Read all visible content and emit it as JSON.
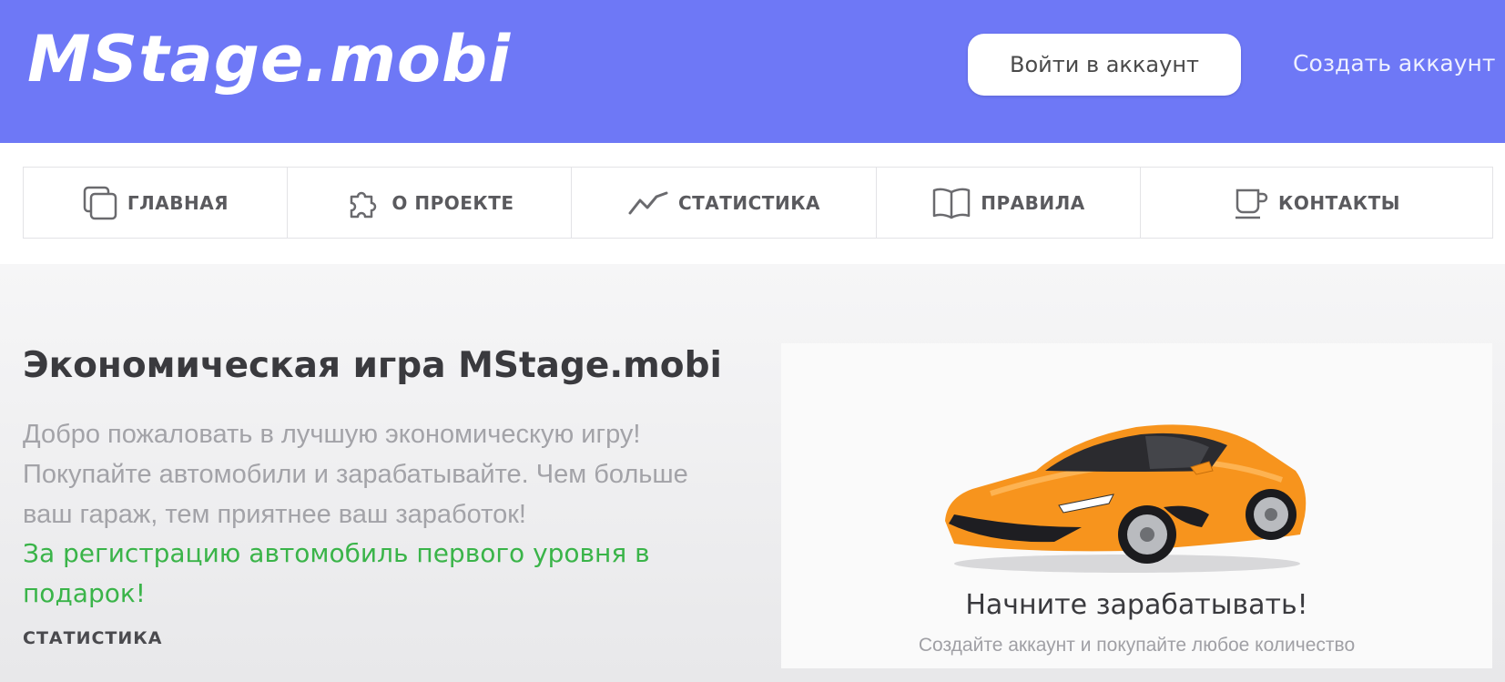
{
  "header": {
    "logo": "MStage.mobi",
    "login_label": "Войти в аккаунт",
    "signup_label": "Создать аккаунт"
  },
  "nav": {
    "items": [
      {
        "label": "ГЛАВНАЯ",
        "icon": "copy-icon"
      },
      {
        "label": "О ПРОЕКТЕ",
        "icon": "puzzle-icon"
      },
      {
        "label": "СТАТИСТИКА",
        "icon": "line-chart-icon"
      },
      {
        "label": "ПРАВИЛА",
        "icon": "book-icon"
      },
      {
        "label": "КОНТАКТЫ",
        "icon": "coffee-cup-icon"
      }
    ]
  },
  "hero": {
    "title": "Экономическая игра MStage.mobi",
    "description": "Добро пожаловать в лучшую экономическую игру! Покупайте автомобили и зарабатывайте. Чем больше ваш гараж, тем приятнее ваш заработок!",
    "gift": "За регистрацию автомобиль первого уровня в подарок!",
    "stats_link": "СТАТИСТИКА"
  },
  "promo": {
    "title": "Начните зарабатывать!",
    "subtitle": "Создайте аккаунт и покупайте любое количество"
  },
  "colors": {
    "header_bg": "#6e78f6",
    "gift_text": "#3ab449",
    "car_body": "#f7941d"
  }
}
